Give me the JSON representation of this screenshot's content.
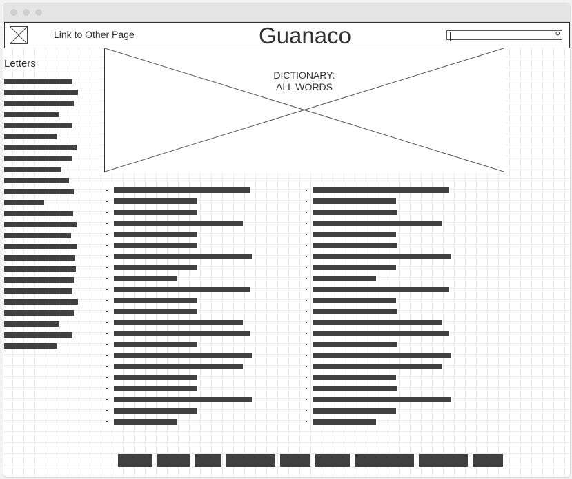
{
  "header": {
    "nav_link": "Link to Other Page",
    "site_title": "Guanaco",
    "search_value": ""
  },
  "sidebar": {
    "title": "Letters"
  },
  "hero": {
    "line1": "DICTIONARY:",
    "line2": "ALL WORDS"
  }
}
